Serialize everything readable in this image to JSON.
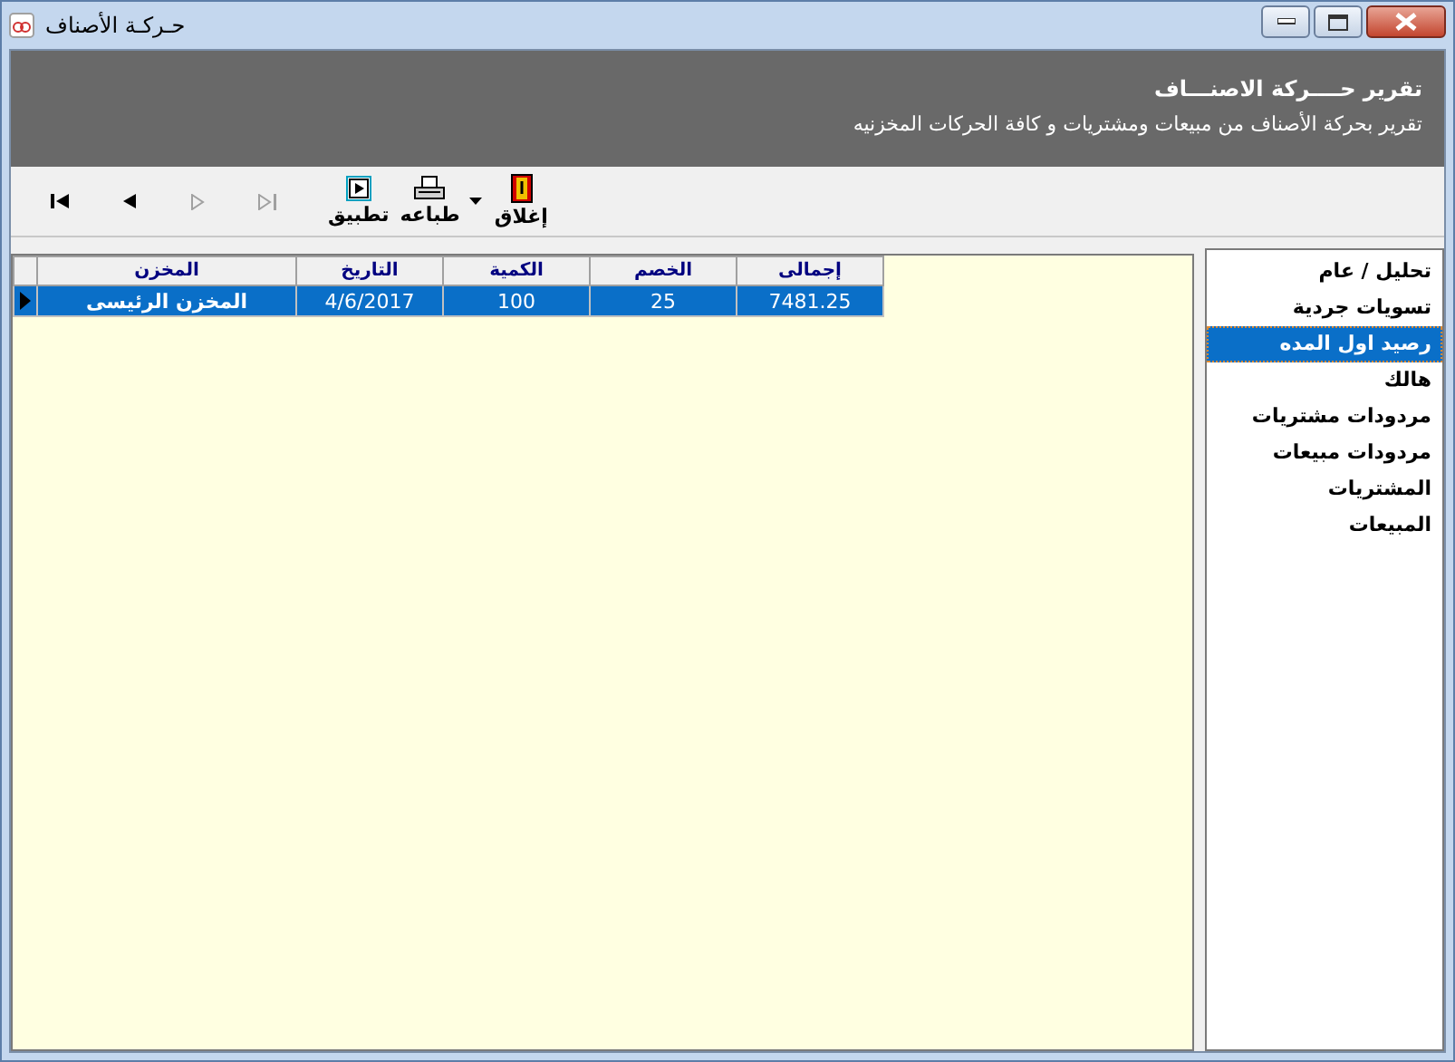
{
  "window": {
    "title": "حـركـة الأصناف"
  },
  "header": {
    "title": "تقرير حــــركة الاصنـــاف",
    "subtitle": "تقرير بحركة الأصناف من مبيعات ومشتريات و كافة الحركات المخزنيه"
  },
  "toolbar": [
    {
      "kind": "close",
      "label": "إغلاق",
      "disabled": false
    },
    {
      "kind": "print",
      "label": "طباعه",
      "disabled": false
    },
    {
      "kind": "apply",
      "label": "تطبيق",
      "disabled": false
    },
    {
      "kind": "last",
      "disabled": true
    },
    {
      "kind": "next",
      "disabled": true
    },
    {
      "kind": "prev",
      "disabled": false
    },
    {
      "kind": "first",
      "disabled": false
    }
  ],
  "table": {
    "columns": [
      "إجمالى",
      "الخصم",
      "الكمية",
      "التاريخ",
      "المخزن"
    ],
    "rows": [
      {
        "cells": [
          "7481.25",
          "25",
          "100",
          "4/6/2017",
          "المخزن الرئيسى"
        ],
        "selected": true
      }
    ]
  },
  "sidebar": {
    "items": [
      {
        "label": "تحليل / عام",
        "selected": false
      },
      {
        "label": "تسويات جردية",
        "selected": false
      },
      {
        "label": "رصيد اول المده",
        "selected": true
      },
      {
        "label": "هالك",
        "selected": false
      },
      {
        "label": "مردودات مشتريات",
        "selected": false
      },
      {
        "label": "مردودات مبيعات",
        "selected": false
      },
      {
        "label": "المشتريات",
        "selected": false
      },
      {
        "label": "المبيعات",
        "selected": false
      }
    ]
  }
}
